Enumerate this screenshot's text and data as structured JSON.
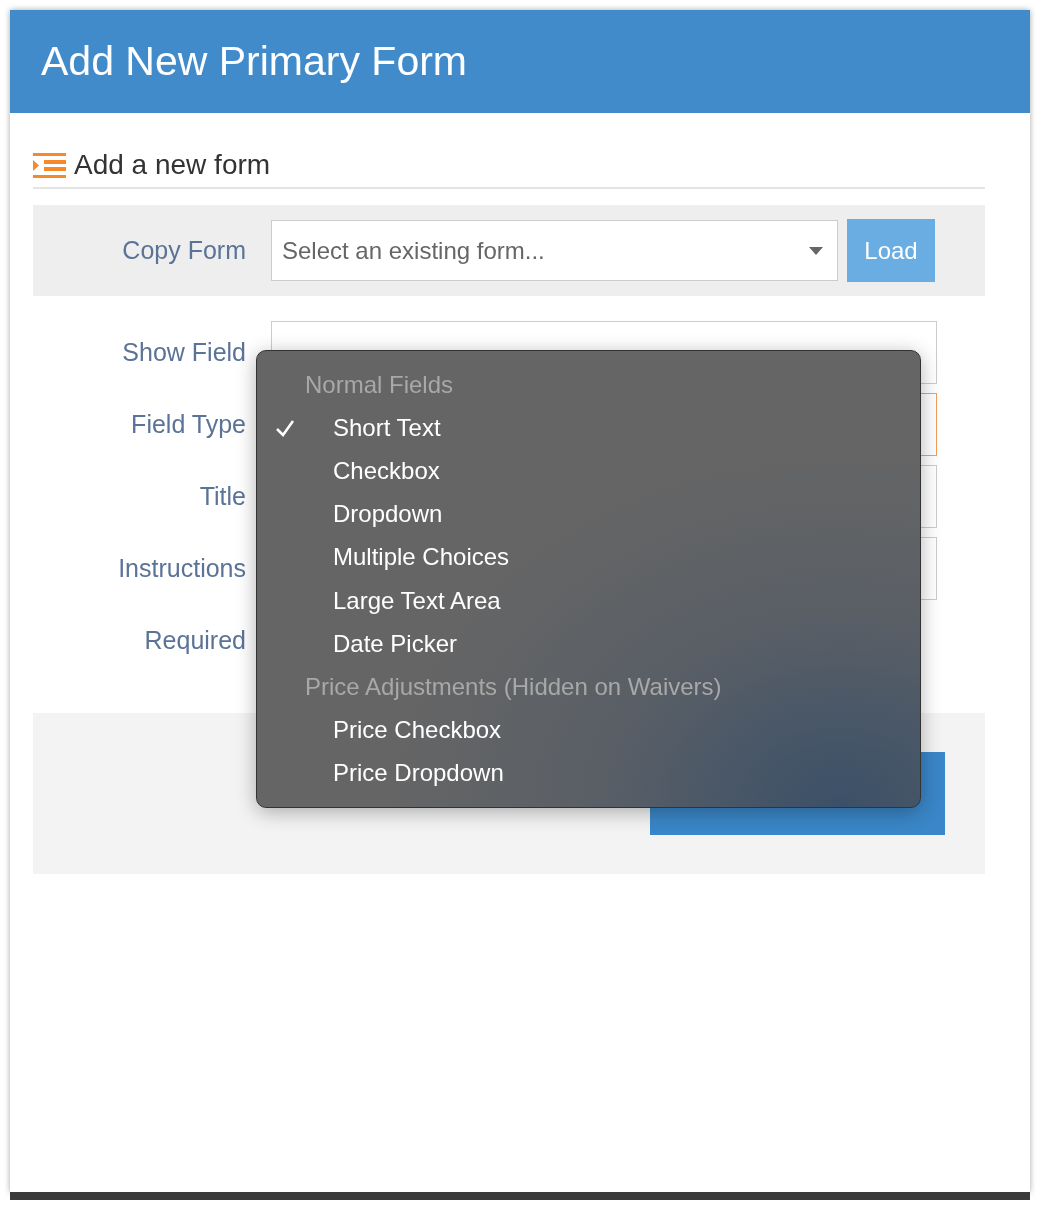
{
  "window": {
    "title": "Add New Primary Form"
  },
  "section": {
    "title": "Add a new form"
  },
  "copy_form": {
    "label": "Copy Form",
    "placeholder": "Select an existing form...",
    "button": "Load"
  },
  "fields": [
    {
      "label": "Show Field",
      "kind": "input"
    },
    {
      "label": "Field Type",
      "kind": "select"
    },
    {
      "label": "Title",
      "kind": "input"
    },
    {
      "label": "Instructions",
      "kind": "input"
    },
    {
      "label": "Required",
      "kind": "none"
    }
  ],
  "menu": {
    "items": [
      {
        "kind": "header",
        "label": "Normal Fields"
      },
      {
        "kind": "option",
        "label": "Short Text",
        "selected": true
      },
      {
        "kind": "option",
        "label": "Checkbox",
        "selected": false
      },
      {
        "kind": "option",
        "label": "Dropdown",
        "selected": false
      },
      {
        "kind": "option",
        "label": "Multiple Choices",
        "selected": false
      },
      {
        "kind": "option",
        "label": "Large Text Area",
        "selected": false
      },
      {
        "kind": "option",
        "label": "Date Picker",
        "selected": false
      },
      {
        "kind": "header",
        "label": "Price Adjustments (Hidden on Waivers)"
      },
      {
        "kind": "option",
        "label": "Price Checkbox",
        "selected": false
      },
      {
        "kind": "option",
        "label": "Price Dropdown",
        "selected": false
      }
    ]
  }
}
